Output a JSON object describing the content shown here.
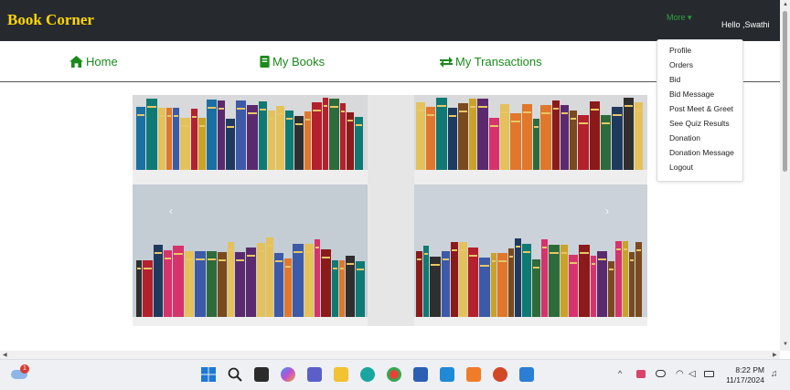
{
  "header": {
    "brand": "Book Corner",
    "more_label": "More ▾",
    "greeting": "Hello ,Swathi"
  },
  "nav": {
    "home": "Home",
    "my_books": "My Books",
    "my_transactions": "My Transactions"
  },
  "dropdown": {
    "items": [
      "Profile",
      "Orders",
      "Bid",
      "Bid Message",
      "Post Meet & Greet",
      "See Quiz Results",
      "Donation",
      "Donation Message",
      "Logout"
    ]
  },
  "carousel": {
    "prev": "‹",
    "next": "›"
  },
  "taskbar": {
    "weather_badge": "1",
    "time": "8:22 PM",
    "date": "11/17/2024"
  },
  "colors": {
    "brand": "#ffd700",
    "nav_green": "#1b8a1b",
    "header_bg": "#262a2f"
  }
}
